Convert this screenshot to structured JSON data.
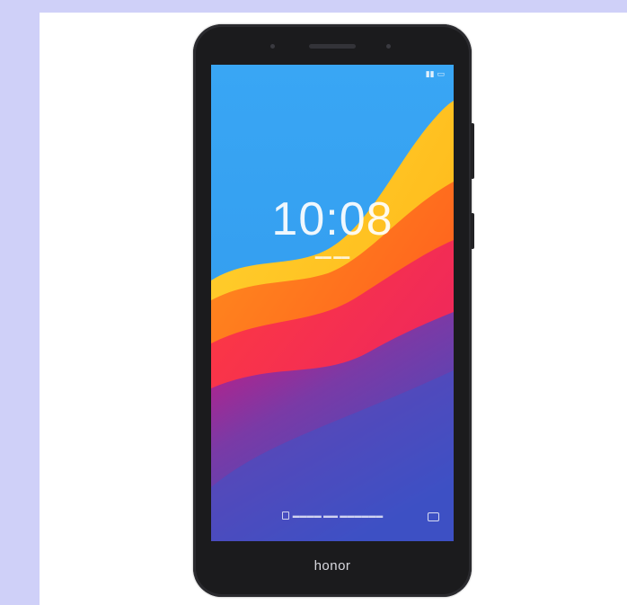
{
  "phone": {
    "clock_time": "10:08",
    "brand_text": "honor"
  },
  "colors": {
    "page_bg": "#cfd0f8",
    "panel_bg": "#ffffff",
    "phone_body": "#1b1b1d",
    "screen_sky": "#3aa4f2",
    "wave_yellow": "#ffc21a",
    "wave_orange": "#ff6a1a",
    "wave_red": "#ff2a52",
    "wave_magenta": "#d0147a",
    "wave_violet": "#6c3aa8",
    "wave_blue": "#3a4fbf"
  },
  "icons": {
    "lock": "lock-icon",
    "camera": "camera-icon"
  }
}
